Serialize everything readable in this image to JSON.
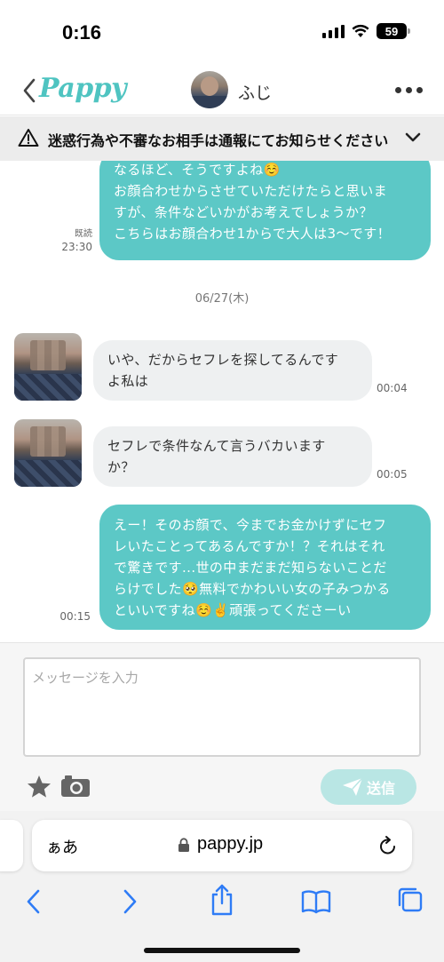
{
  "status_bar": {
    "time": "0:16",
    "battery": "59"
  },
  "header": {
    "logo": "Pappy",
    "contact_name": "ふじ"
  },
  "warning": {
    "text": "迷惑行為や不審なお相手は通報にてお知らせください"
  },
  "messages": [
    {
      "from": "me",
      "lines": [
        "なるほど、そうですよね☺️",
        "お顔合わせからさせていただけたらと思いま",
        "すが、条件などいかがお考えでしょうか？",
        "こちらはお顔合わせ1からで大人は3〜です！"
      ],
      "read": "既読",
      "time": "23:30"
    },
    {
      "type": "date",
      "text": "06/27(木)"
    },
    {
      "from": "them",
      "lines": [
        "いや、だからセフレを探してるんです",
        "よ私は"
      ],
      "time": "00:04"
    },
    {
      "from": "them",
      "lines": [
        "セフレで条件なんて言うバカいます",
        "か？"
      ],
      "time": "00:05"
    },
    {
      "from": "me",
      "lines": [
        "えー！そのお顔で、今までお金かけずにセフ",
        "レいたことってあるんですか！？それはそれ",
        "で驚きです...世の中まだまだ知らないことだ",
        "らけでした🥺無料でかわいい女の子みつかる",
        "といいですね☺️✌️頑張ってくださーい"
      ],
      "time": "00:15"
    }
  ],
  "composer": {
    "placeholder": "メッセージを入力",
    "send_label": "送信"
  },
  "safari": {
    "aa_label": "ぁあ",
    "url": "pappy.jp"
  },
  "colors": {
    "accent": "#5cc8c6",
    "send_disabled": "#b9e6e4",
    "bubble_other": "#eef0f1",
    "safari_blue": "#2f7cf6"
  },
  "icons": [
    "back-chevron-icon",
    "more-icon",
    "warning-icon",
    "chevron-down-icon",
    "star-icon",
    "camera-icon",
    "paper-plane-icon",
    "lock-icon",
    "reload-icon",
    "back-icon",
    "forward-icon",
    "share-icon",
    "bookmarks-icon",
    "tabs-icon"
  ]
}
